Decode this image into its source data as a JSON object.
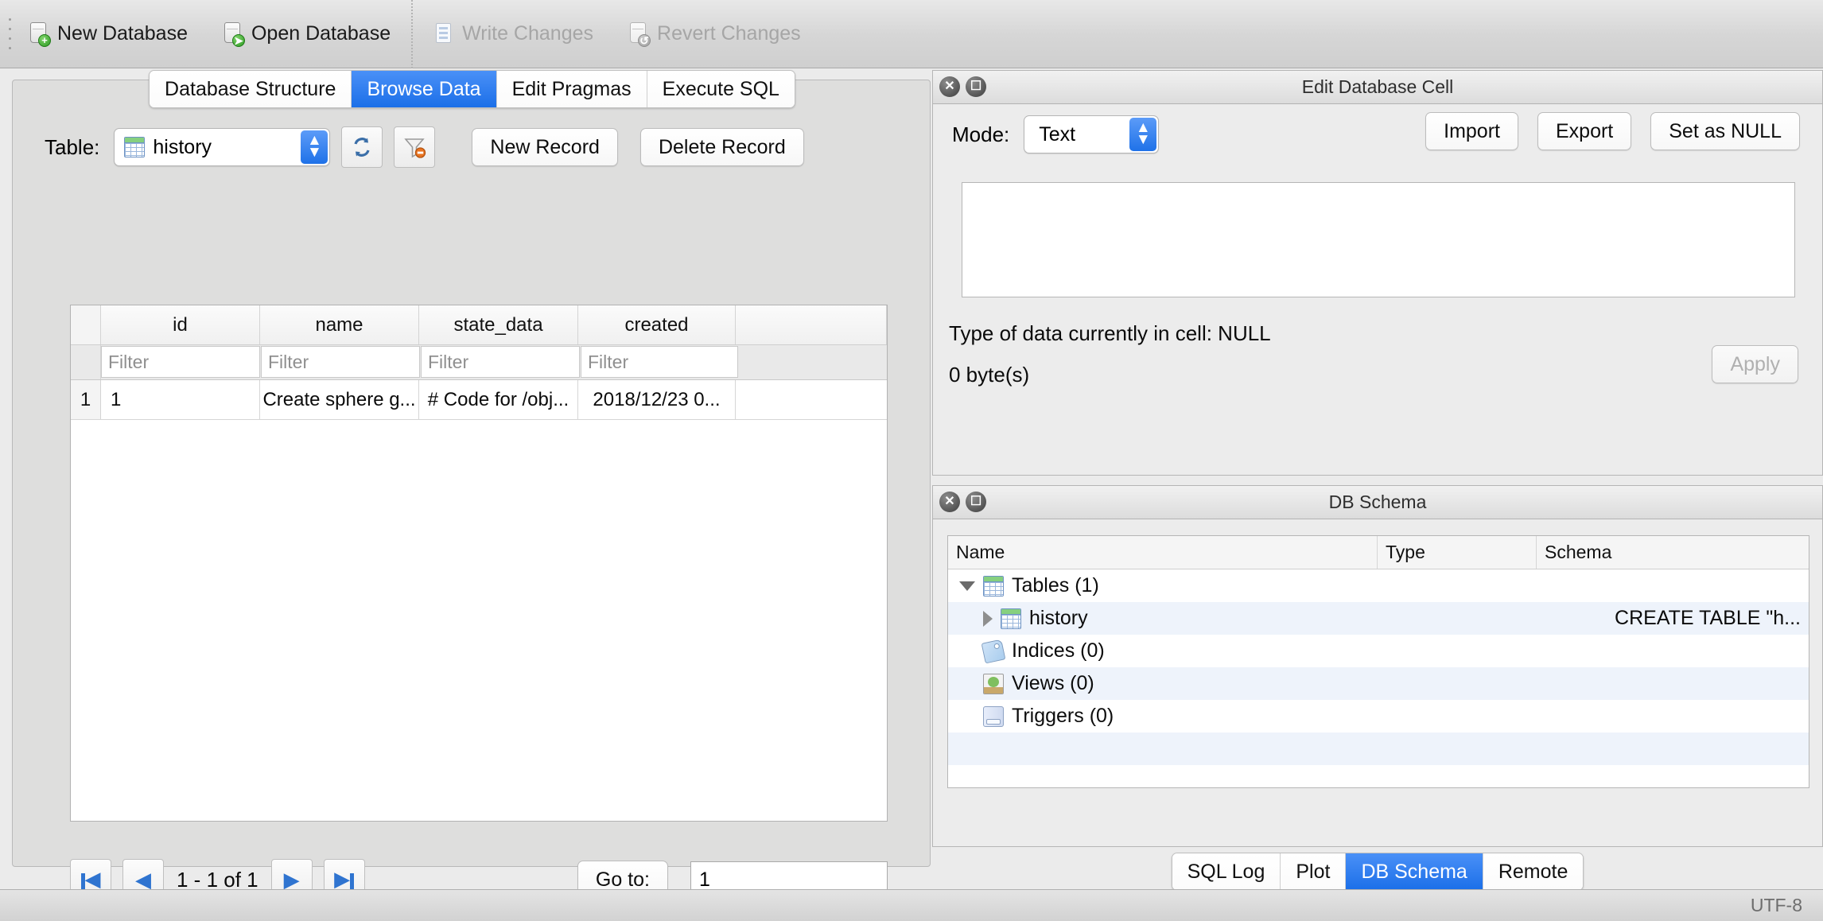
{
  "toolbar": {
    "items": [
      {
        "label": "New Database",
        "icon": "new-database-icon",
        "enabled": true
      },
      {
        "label": "Open Database",
        "icon": "open-database-icon",
        "enabled": true
      },
      {
        "label": "Write Changes",
        "icon": "write-changes-icon",
        "enabled": false
      },
      {
        "label": "Revert Changes",
        "icon": "revert-changes-icon",
        "enabled": false
      }
    ]
  },
  "main_tabs": {
    "items": [
      {
        "label": "Database Structure",
        "active": false
      },
      {
        "label": "Browse Data",
        "active": true
      },
      {
        "label": "Edit Pragmas",
        "active": false
      },
      {
        "label": "Execute SQL",
        "active": false
      }
    ]
  },
  "browse": {
    "table_label": "Table:",
    "table_selected": "history",
    "refresh_icon": "refresh-icon",
    "filter_icon": "clear-filter-icon",
    "new_record_label": "New Record",
    "delete_record_label": "Delete Record",
    "grid": {
      "columns": [
        "id",
        "name",
        "state_data",
        "created"
      ],
      "filter_placeholder": "Filter",
      "rows": [
        {
          "num": "1",
          "cells": [
            "1",
            "Create sphere g...",
            "# Code for /obj...",
            "2018/12/23 0..."
          ]
        }
      ]
    },
    "pagination": {
      "first_icon": "first-page-icon",
      "prev_icon": "previous-page-icon",
      "next_icon": "next-page-icon",
      "last_icon": "last-page-icon",
      "info": "1 - 1 of 1",
      "goto_label": "Go to:",
      "goto_value": "1"
    }
  },
  "edit_cell": {
    "title": "Edit Database Cell",
    "close_icon": "close-icon",
    "float_icon": "undock-icon",
    "mode_label": "Mode:",
    "mode_value": "Text",
    "import_label": "Import",
    "export_label": "Export",
    "set_null_label": "Set as NULL",
    "editor_value": "",
    "type_info": "Type of data currently in cell: NULL",
    "size_info": "0 byte(s)",
    "apply_label": "Apply",
    "apply_enabled": false
  },
  "db_schema": {
    "title": "DB Schema",
    "close_icon": "close-icon",
    "float_icon": "undock-icon",
    "columns": [
      "Name",
      "Type",
      "Schema"
    ],
    "rows": [
      {
        "label": "Tables (1)",
        "icon": "table-icon",
        "indent": 0,
        "twisty": "down",
        "type": "",
        "schema": ""
      },
      {
        "label": "history",
        "icon": "table-icon",
        "indent": 1,
        "twisty": "right",
        "type": "",
        "schema": "CREATE TABLE \"h..."
      },
      {
        "label": "Indices (0)",
        "icon": "index-icon",
        "indent": 0,
        "twisty": "none",
        "type": "",
        "schema": ""
      },
      {
        "label": "Views (0)",
        "icon": "view-icon",
        "indent": 0,
        "twisty": "none",
        "type": "",
        "schema": ""
      },
      {
        "label": "Triggers (0)",
        "icon": "trigger-icon",
        "indent": 0,
        "twisty": "none",
        "type": "",
        "schema": ""
      }
    ]
  },
  "bottom_tabs": {
    "items": [
      {
        "label": "SQL Log",
        "active": false
      },
      {
        "label": "Plot",
        "active": false
      },
      {
        "label": "DB Schema",
        "active": true
      },
      {
        "label": "Remote",
        "active": false
      }
    ]
  },
  "statusbar": {
    "encoding": "UTF-8"
  },
  "colors": {
    "accent": "#1b6fe8",
    "window": "#ebebeb",
    "panel": "#dededd"
  }
}
